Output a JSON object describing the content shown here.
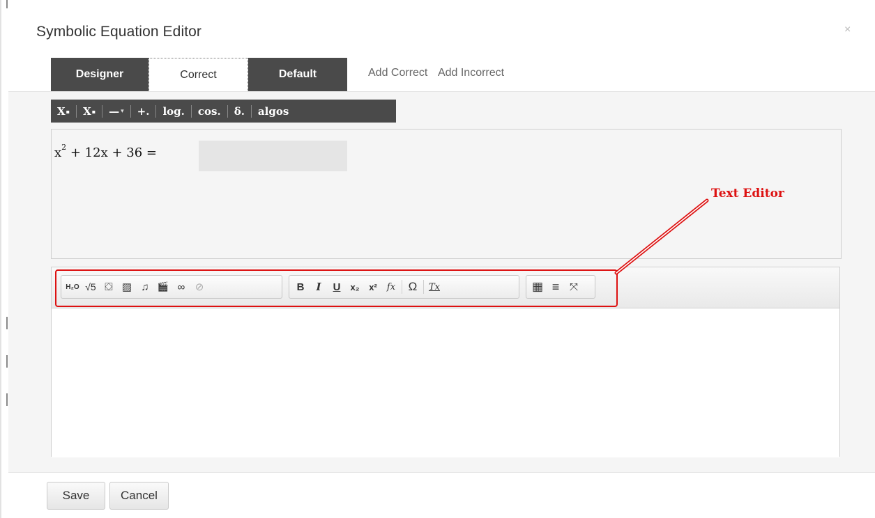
{
  "dialog": {
    "title": "Symbolic Equation Editor",
    "close_glyph": "×"
  },
  "tabs": [
    {
      "label": "Designer",
      "active": false
    },
    {
      "label": "Correct",
      "active": true
    },
    {
      "label": "Default",
      "active": false
    }
  ],
  "links": {
    "add_correct": "Add Correct",
    "add_incorrect": "Add Incorrect"
  },
  "math_toolbar": {
    "superscript": {
      "label": "X",
      "mark": "▪"
    },
    "subscript": {
      "label": "X",
      "mark": "▪"
    },
    "fraction": {
      "label": "—"
    },
    "operators": {
      "label": "+."
    },
    "log": {
      "label": "log."
    },
    "trig": {
      "label": "cos."
    },
    "greek": {
      "label": "δ."
    },
    "algos": {
      "label": "algos"
    },
    "caret": "▾"
  },
  "equation": {
    "base": "x",
    "exponent": "2",
    "rest": " + 12x + 36 = "
  },
  "annotation": {
    "label": "Text Editor",
    "color": "#dd1111"
  },
  "editor_toolbar": {
    "group1": [
      {
        "icon": "chemistry-icon",
        "glyph": "H₂O"
      },
      {
        "icon": "sqrt-icon",
        "glyph": "√5"
      },
      {
        "icon": "paint-bucket-icon",
        "glyph": "⛋"
      },
      {
        "icon": "image-icon",
        "glyph": "▨"
      },
      {
        "icon": "music-note-icon",
        "glyph": "♫"
      },
      {
        "icon": "clapperboard-icon",
        "glyph": "🎬"
      },
      {
        "icon": "link-icon",
        "glyph": "∞"
      },
      {
        "icon": "unlink-icon",
        "glyph": "⊘"
      }
    ],
    "group2": [
      {
        "icon": "bold-icon",
        "glyph": "B"
      },
      {
        "icon": "italic-icon",
        "glyph": "I"
      },
      {
        "icon": "underline-icon",
        "glyph": "U"
      },
      {
        "icon": "subscript-icon",
        "glyph": "x₂"
      },
      {
        "icon": "superscript-icon",
        "glyph": "x²"
      },
      {
        "icon": "formula-icon",
        "glyph": "fx"
      },
      {
        "icon": "special-char-icon",
        "glyph": "Ω"
      },
      {
        "icon": "remove-format-icon",
        "glyph": "Tx"
      }
    ],
    "group3": [
      {
        "icon": "table-icon",
        "glyph": "▦"
      },
      {
        "icon": "horizontal-rule-icon",
        "glyph": "≡"
      },
      {
        "icon": "maximize-icon",
        "glyph": "⤧"
      }
    ]
  },
  "footer": {
    "save_label": "Save",
    "cancel_label": "Cancel"
  }
}
